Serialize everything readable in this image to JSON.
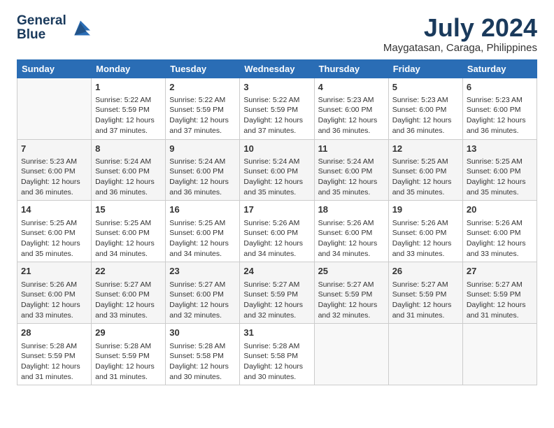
{
  "header": {
    "logo_line1": "General",
    "logo_line2": "Blue",
    "month_year": "July 2024",
    "location": "Maygatasan, Caraga, Philippines"
  },
  "days_of_week": [
    "Sunday",
    "Monday",
    "Tuesday",
    "Wednesday",
    "Thursday",
    "Friday",
    "Saturday"
  ],
  "weeks": [
    [
      {
        "day": "",
        "empty": true
      },
      {
        "day": "1",
        "sunrise": "Sunrise: 5:22 AM",
        "sunset": "Sunset: 5:59 PM",
        "daylight": "Daylight: 12 hours and 37 minutes."
      },
      {
        "day": "2",
        "sunrise": "Sunrise: 5:22 AM",
        "sunset": "Sunset: 5:59 PM",
        "daylight": "Daylight: 12 hours and 37 minutes."
      },
      {
        "day": "3",
        "sunrise": "Sunrise: 5:22 AM",
        "sunset": "Sunset: 5:59 PM",
        "daylight": "Daylight: 12 hours and 37 minutes."
      },
      {
        "day": "4",
        "sunrise": "Sunrise: 5:23 AM",
        "sunset": "Sunset: 6:00 PM",
        "daylight": "Daylight: 12 hours and 36 minutes."
      },
      {
        "day": "5",
        "sunrise": "Sunrise: 5:23 AM",
        "sunset": "Sunset: 6:00 PM",
        "daylight": "Daylight: 12 hours and 36 minutes."
      },
      {
        "day": "6",
        "sunrise": "Sunrise: 5:23 AM",
        "sunset": "Sunset: 6:00 PM",
        "daylight": "Daylight: 12 hours and 36 minutes."
      }
    ],
    [
      {
        "day": "7",
        "sunrise": "Sunrise: 5:23 AM",
        "sunset": "Sunset: 6:00 PM",
        "daylight": "Daylight: 12 hours and 36 minutes."
      },
      {
        "day": "8",
        "sunrise": "Sunrise: 5:24 AM",
        "sunset": "Sunset: 6:00 PM",
        "daylight": "Daylight: 12 hours and 36 minutes."
      },
      {
        "day": "9",
        "sunrise": "Sunrise: 5:24 AM",
        "sunset": "Sunset: 6:00 PM",
        "daylight": "Daylight: 12 hours and 36 minutes."
      },
      {
        "day": "10",
        "sunrise": "Sunrise: 5:24 AM",
        "sunset": "Sunset: 6:00 PM",
        "daylight": "Daylight: 12 hours and 35 minutes."
      },
      {
        "day": "11",
        "sunrise": "Sunrise: 5:24 AM",
        "sunset": "Sunset: 6:00 PM",
        "daylight": "Daylight: 12 hours and 35 minutes."
      },
      {
        "day": "12",
        "sunrise": "Sunrise: 5:25 AM",
        "sunset": "Sunset: 6:00 PM",
        "daylight": "Daylight: 12 hours and 35 minutes."
      },
      {
        "day": "13",
        "sunrise": "Sunrise: 5:25 AM",
        "sunset": "Sunset: 6:00 PM",
        "daylight": "Daylight: 12 hours and 35 minutes."
      }
    ],
    [
      {
        "day": "14",
        "sunrise": "Sunrise: 5:25 AM",
        "sunset": "Sunset: 6:00 PM",
        "daylight": "Daylight: 12 hours and 35 minutes."
      },
      {
        "day": "15",
        "sunrise": "Sunrise: 5:25 AM",
        "sunset": "Sunset: 6:00 PM",
        "daylight": "Daylight: 12 hours and 34 minutes."
      },
      {
        "day": "16",
        "sunrise": "Sunrise: 5:25 AM",
        "sunset": "Sunset: 6:00 PM",
        "daylight": "Daylight: 12 hours and 34 minutes."
      },
      {
        "day": "17",
        "sunrise": "Sunrise: 5:26 AM",
        "sunset": "Sunset: 6:00 PM",
        "daylight": "Daylight: 12 hours and 34 minutes."
      },
      {
        "day": "18",
        "sunrise": "Sunrise: 5:26 AM",
        "sunset": "Sunset: 6:00 PM",
        "daylight": "Daylight: 12 hours and 34 minutes."
      },
      {
        "day": "19",
        "sunrise": "Sunrise: 5:26 AM",
        "sunset": "Sunset: 6:00 PM",
        "daylight": "Daylight: 12 hours and 33 minutes."
      },
      {
        "day": "20",
        "sunrise": "Sunrise: 5:26 AM",
        "sunset": "Sunset: 6:00 PM",
        "daylight": "Daylight: 12 hours and 33 minutes."
      }
    ],
    [
      {
        "day": "21",
        "sunrise": "Sunrise: 5:26 AM",
        "sunset": "Sunset: 6:00 PM",
        "daylight": "Daylight: 12 hours and 33 minutes."
      },
      {
        "day": "22",
        "sunrise": "Sunrise: 5:27 AM",
        "sunset": "Sunset: 6:00 PM",
        "daylight": "Daylight: 12 hours and 33 minutes."
      },
      {
        "day": "23",
        "sunrise": "Sunrise: 5:27 AM",
        "sunset": "Sunset: 6:00 PM",
        "daylight": "Daylight: 12 hours and 32 minutes."
      },
      {
        "day": "24",
        "sunrise": "Sunrise: 5:27 AM",
        "sunset": "Sunset: 5:59 PM",
        "daylight": "Daylight: 12 hours and 32 minutes."
      },
      {
        "day": "25",
        "sunrise": "Sunrise: 5:27 AM",
        "sunset": "Sunset: 5:59 PM",
        "daylight": "Daylight: 12 hours and 32 minutes."
      },
      {
        "day": "26",
        "sunrise": "Sunrise: 5:27 AM",
        "sunset": "Sunset: 5:59 PM",
        "daylight": "Daylight: 12 hours and 31 minutes."
      },
      {
        "day": "27",
        "sunrise": "Sunrise: 5:27 AM",
        "sunset": "Sunset: 5:59 PM",
        "daylight": "Daylight: 12 hours and 31 minutes."
      }
    ],
    [
      {
        "day": "28",
        "sunrise": "Sunrise: 5:28 AM",
        "sunset": "Sunset: 5:59 PM",
        "daylight": "Daylight: 12 hours and 31 minutes."
      },
      {
        "day": "29",
        "sunrise": "Sunrise: 5:28 AM",
        "sunset": "Sunset: 5:59 PM",
        "daylight": "Daylight: 12 hours and 31 minutes."
      },
      {
        "day": "30",
        "sunrise": "Sunrise: 5:28 AM",
        "sunset": "Sunset: 5:58 PM",
        "daylight": "Daylight: 12 hours and 30 minutes."
      },
      {
        "day": "31",
        "sunrise": "Sunrise: 5:28 AM",
        "sunset": "Sunset: 5:58 PM",
        "daylight": "Daylight: 12 hours and 30 minutes."
      },
      {
        "day": "",
        "empty": true
      },
      {
        "day": "",
        "empty": true
      },
      {
        "day": "",
        "empty": true
      }
    ]
  ]
}
